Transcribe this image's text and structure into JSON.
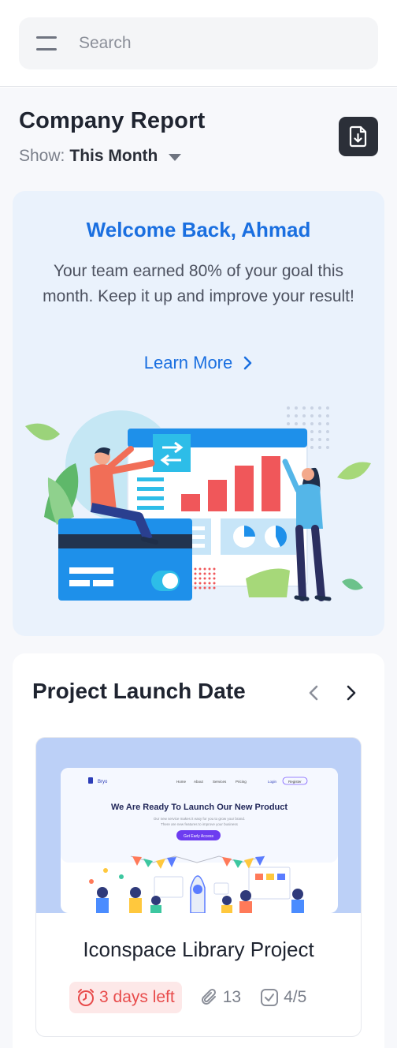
{
  "search": {
    "placeholder": "Search"
  },
  "header": {
    "title": "Company Report",
    "show_label": "Show:",
    "show_value": "This Month"
  },
  "welcome": {
    "title": "Welcome Back, Ahmad",
    "message": "Your team earned 80% of your goal this month. Keep it up and improve your result!",
    "link_label": "Learn More"
  },
  "projects": {
    "title": "Project Launch Date",
    "items": [
      {
        "name": "Iconspace Library Project",
        "days_left": "3 days left",
        "attachments": "13",
        "tasks": "4/5",
        "preview": {
          "brand": "Bryo",
          "nav": [
            "Home",
            "About",
            "Services",
            "Pricing"
          ],
          "login": "Login",
          "register": "Register",
          "headline": "We Are Ready To Launch Our New Product",
          "subtext_line1": "Our new service makes it easy for you to grow your brand.",
          "subtext_line2": "There are new features to improve your business",
          "cta": "Get Early Access"
        }
      }
    ]
  },
  "colors": {
    "accent": "#1a6fe0",
    "danger": "#e84b4b",
    "danger_bg": "#fde8e8",
    "card_bg": "#eaf2fc",
    "dark_button": "#2b2f38"
  }
}
